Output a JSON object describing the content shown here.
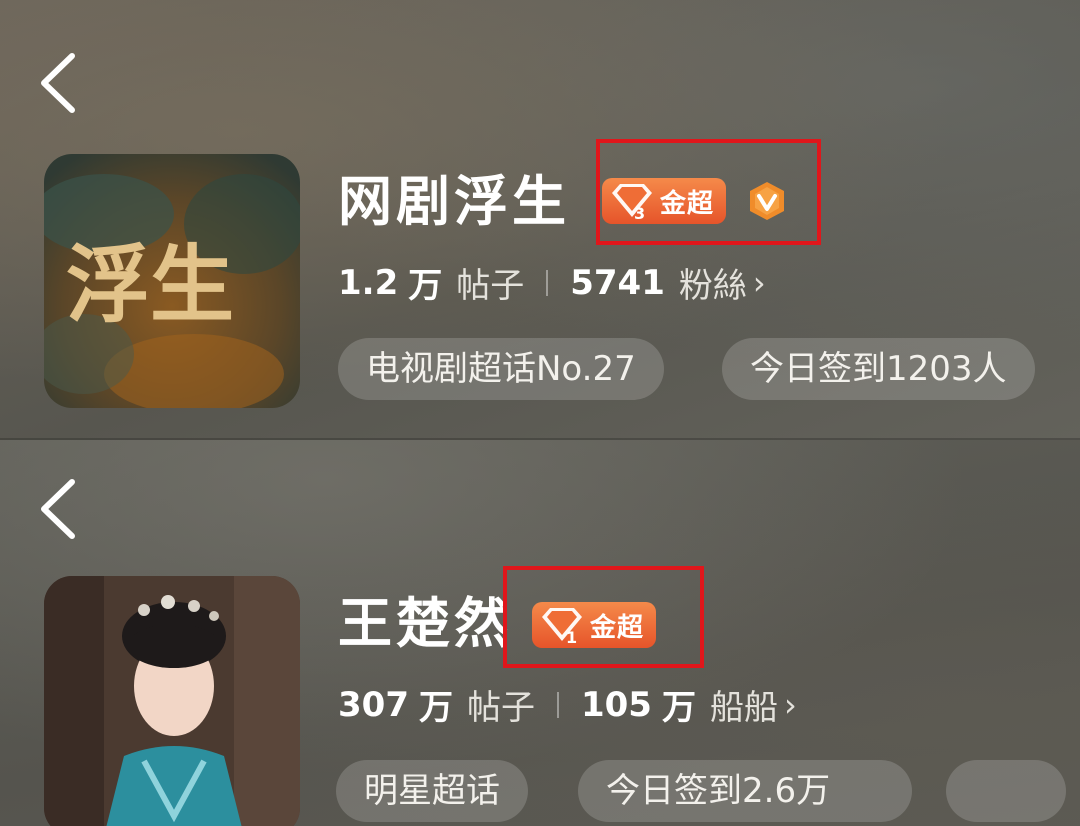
{
  "cards": [
    {
      "title": "网剧浮生",
      "avatar_text": "浮生",
      "badge": {
        "level": "3",
        "label": "金超"
      },
      "verified_icon": "v-badge-icon",
      "stats": {
        "posts_num": "1.2",
        "posts_unit": "万",
        "posts_label": "帖子",
        "fans_num": "5741",
        "fans_unit": "",
        "fans_label": "粉絲"
      },
      "chips": [
        "电视剧超话No.27",
        "今日签到1203人"
      ]
    },
    {
      "title": "王楚然",
      "badge": {
        "level": "1",
        "label": "金超"
      },
      "stats": {
        "posts_num": "307",
        "posts_unit": "万",
        "posts_label": "帖子",
        "fans_num": "105",
        "fans_unit": "万",
        "fans_label": "船船"
      },
      "chips": [
        "明星超话",
        "今日签到2.6万"
      ]
    }
  ],
  "colors": {
    "badge": "#ea5f2f",
    "highlight": "#e0161b",
    "verified": "#f08c2a"
  }
}
